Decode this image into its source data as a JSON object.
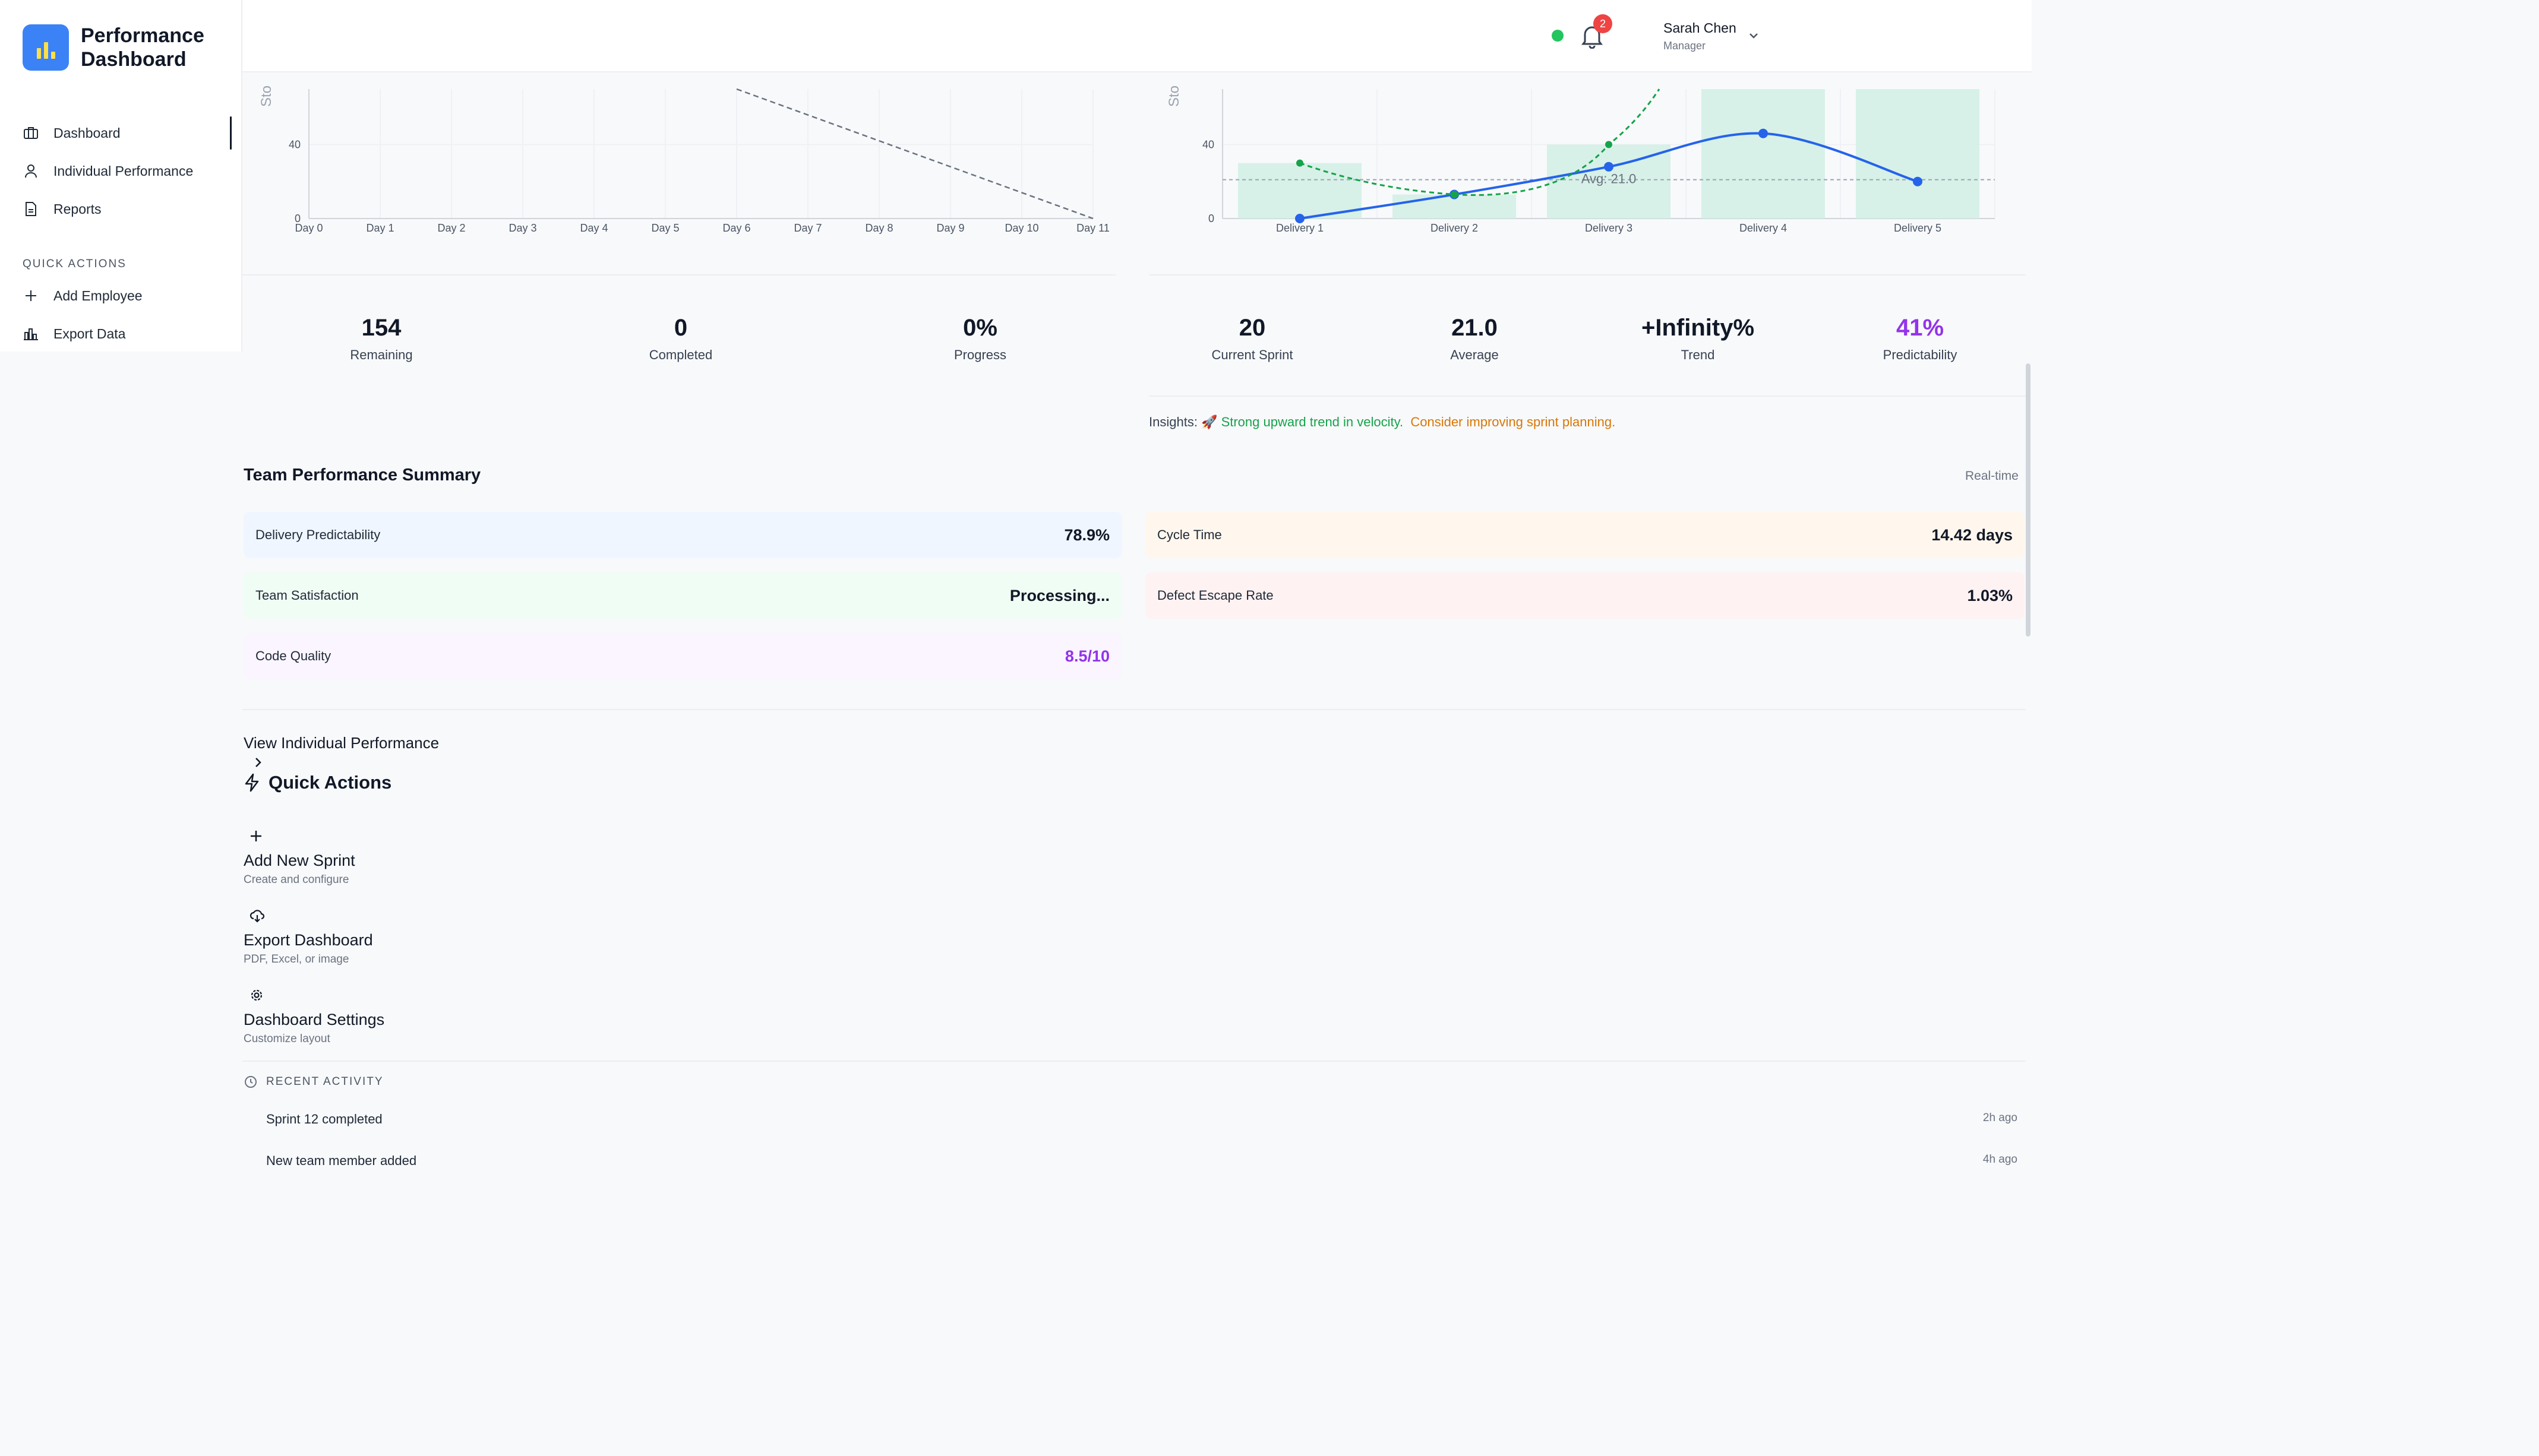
{
  "app": {
    "title": "Performance Dashboard"
  },
  "sidebar": {
    "nav": [
      {
        "label": "Dashboard",
        "icon": "briefcase-icon",
        "active": true
      },
      {
        "label": "Individual Performance",
        "icon": "user-icon",
        "active": false
      },
      {
        "label": "Reports",
        "icon": "document-icon",
        "active": false
      }
    ],
    "quick_actions_heading": "QUICK ACTIONS",
    "quick_actions": [
      {
        "label": "Add Employee",
        "icon": "plus-icon"
      },
      {
        "label": "Export Data",
        "icon": "bar-chart-icon"
      }
    ]
  },
  "header": {
    "status": "online",
    "notifications_count": "2",
    "user_name": "Sarah Chen",
    "user_role": "Manager"
  },
  "burndown": {
    "y_label": "Sto",
    "y_ticks": [
      "40",
      "0"
    ],
    "x_ticks": [
      "Day 0",
      "Day 1",
      "Day 2",
      "Day 3",
      "Day 4",
      "Day 5",
      "Day 6",
      "Day 7",
      "Day 8",
      "Day 9",
      "Day 10",
      "Day 11"
    ],
    "stats": [
      {
        "value": "154",
        "label": "Remaining"
      },
      {
        "value": "0",
        "label": "Completed"
      },
      {
        "value": "0%",
        "label": "Progress"
      }
    ]
  },
  "velocity": {
    "y_label": "Sto",
    "y_ticks": [
      "40",
      "0"
    ],
    "x_ticks": [
      "Delivery 1",
      "Delivery 2",
      "Delivery 3",
      "Delivery 4",
      "Delivery 5"
    ],
    "avg_label": "Avg: 21.0",
    "stats": [
      {
        "value": "20",
        "label": "Current Sprint"
      },
      {
        "value": "21.0",
        "label": "Average"
      },
      {
        "value": "+Infinity%",
        "label": "Trend"
      },
      {
        "value": "41%",
        "label": "Predictability"
      }
    ],
    "insights_prefix": "Insights:",
    "insight_good": "🚀 Strong upward trend in velocity.",
    "insight_warn": "Consider improving sprint planning."
  },
  "chart_data": [
    {
      "type": "line",
      "title": "",
      "x": [
        "Day 0",
        "Day 1",
        "Day 2",
        "Day 3",
        "Day 4",
        "Day 5",
        "Day 6",
        "Day 7",
        "Day 8",
        "Day 9",
        "Day 10",
        "Day 11"
      ],
      "series": [
        {
          "name": "",
          "style": "dashed",
          "color": "#6b7280",
          "points": [
            [
              6,
              70
            ],
            [
              11,
              0
            ]
          ]
        }
      ],
      "ylabel": "Sto",
      "ylim": [
        0,
        70
      ],
      "y_ticks": [
        0,
        40
      ],
      "grid": true
    },
    {
      "type": "bar",
      "title": "",
      "categories": [
        "Delivery 1",
        "Delivery 2",
        "Delivery 3",
        "Delivery 4",
        "Delivery 5"
      ],
      "series": [
        {
          "name": "",
          "kind": "bar",
          "color": "#d1f0e4",
          "values": [
            30,
            13,
            40,
            70,
            70
          ]
        },
        {
          "name": "",
          "kind": "line",
          "color": "#2563eb",
          "values": [
            0,
            13,
            28,
            46,
            20
          ]
        },
        {
          "name": "",
          "kind": "dashed-line",
          "color": "#16a34a",
          "values": [
            30,
            13,
            40,
            null,
            null
          ]
        }
      ],
      "average": 21.0,
      "ylabel": "Sto",
      "ylim": [
        0,
        70
      ],
      "y_ticks": [
        0,
        40
      ],
      "grid": true
    }
  ],
  "team_summary": {
    "title": "Team Performance Summary",
    "realtime_label": "Real-time",
    "metrics": [
      {
        "label": "Delivery Predictability",
        "value": "78.9%",
        "bg": "#eff6ff",
        "value_color": "#111827"
      },
      {
        "label": "Cycle Time",
        "value": "14.42 days",
        "bg": "#fff7ed",
        "value_color": "#111827"
      },
      {
        "label": "Team Satisfaction",
        "value": "Processing...",
        "bg": "#f0fdf4",
        "value_color": "#111827"
      },
      {
        "label": "Defect Escape Rate",
        "value": "1.03%",
        "bg": "#fef2f2",
        "value_color": "#111827"
      },
      {
        "label": "Code Quality",
        "value": "8.5/10",
        "bg": "#faf5ff",
        "value_color": "#9333ea"
      }
    ]
  },
  "quick_actions": {
    "view_link": "View Individual Performance",
    "title": "Quick Actions",
    "cards": [
      {
        "title": "Add New Sprint",
        "subtitle": "Create and configure",
        "icon": "plus-icon"
      },
      {
        "title": "Export Dashboard",
        "subtitle": "PDF, Excel, or image",
        "icon": "cloud-download-icon"
      },
      {
        "title": "Dashboard Settings",
        "subtitle": "Customize layout",
        "icon": "gear-icon"
      }
    ]
  },
  "recent_activity": {
    "heading": "RECENT ACTIVITY",
    "items": [
      {
        "text": "Sprint 12 completed",
        "time": "2h ago"
      },
      {
        "text": "New team member added",
        "time": "4h ago"
      }
    ]
  },
  "colors": {
    "accent": "#3b82f6",
    "velocity_line": "#2563eb",
    "forecast_line": "#16a34a",
    "bar_fill": "#d1f0e4",
    "predictability": "#9333ea"
  }
}
